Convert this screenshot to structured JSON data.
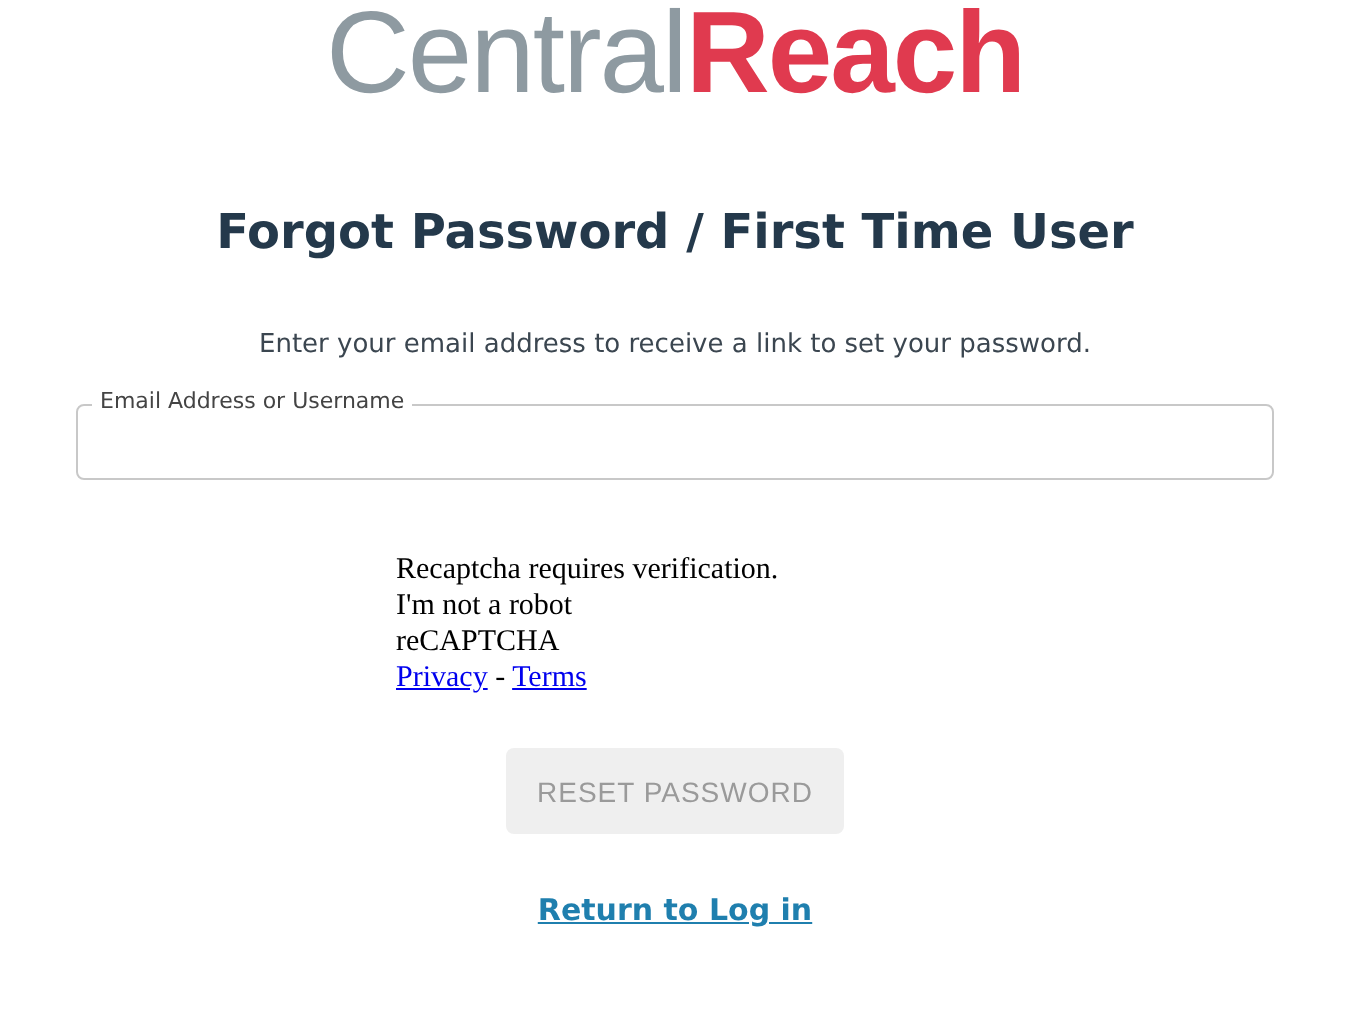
{
  "logo": {
    "first": "Central",
    "second": "Reach"
  },
  "title": "Forgot Password / First Time User",
  "instructions": "Enter your email address to receive a link to set your password.",
  "email_field": {
    "label": "Email Address or Username"
  },
  "recaptcha": {
    "message": "Recaptcha requires verification.",
    "checkbox_label": "I'm not a robot",
    "brand": "reCAPTCHA",
    "privacy_link": "Privacy",
    "separator": "-",
    "terms_link": "Terms"
  },
  "reset_button": {
    "label": "RESET PASSWORD",
    "disabled": true
  },
  "return_link": "Return to Log in"
}
